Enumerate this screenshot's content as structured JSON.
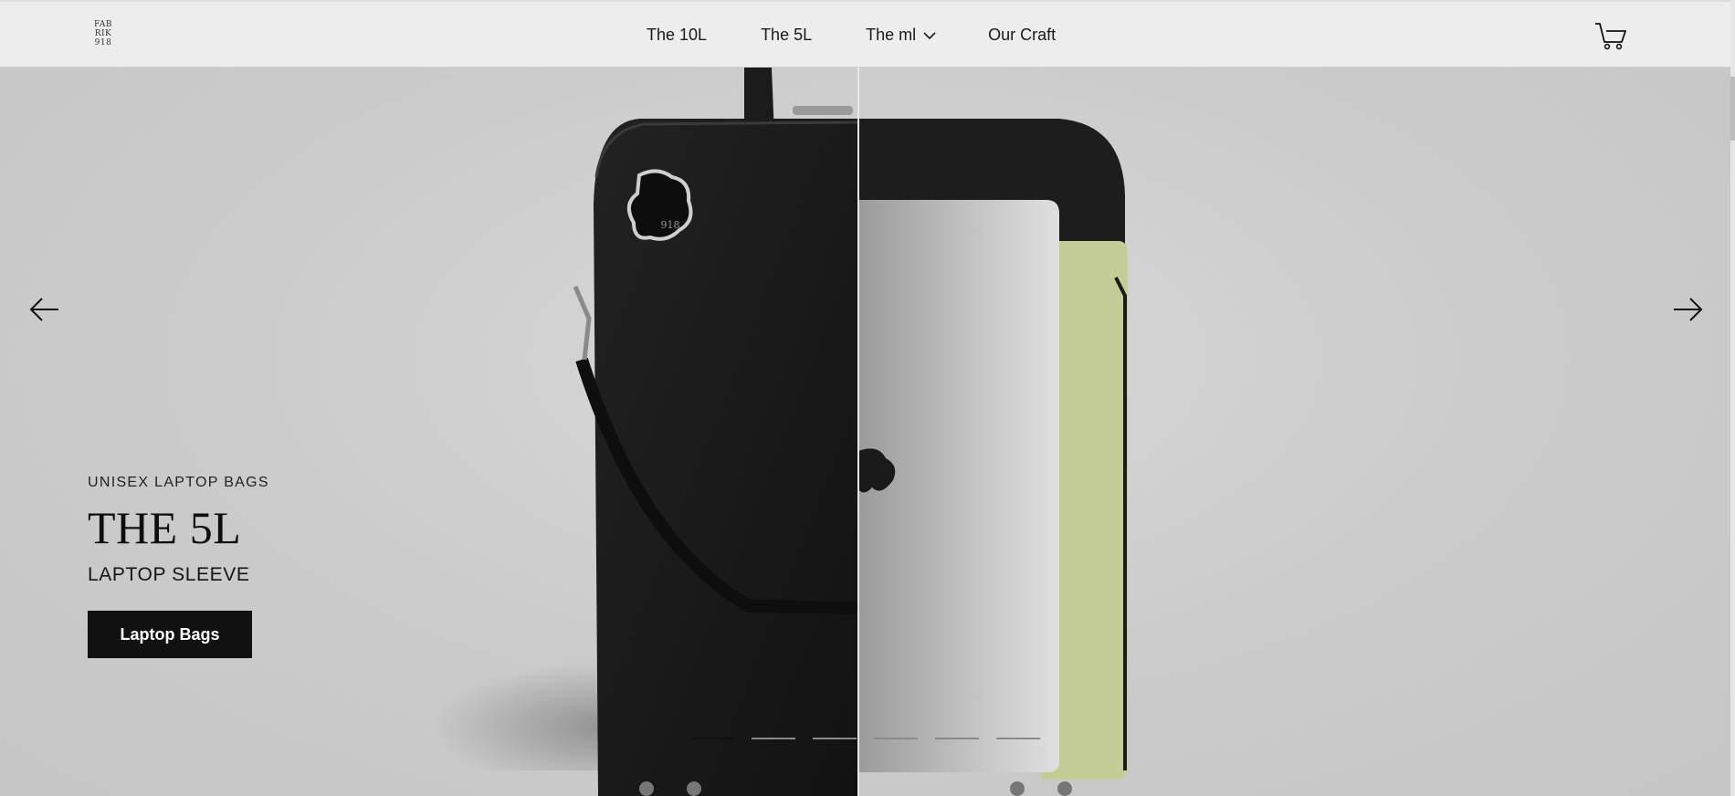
{
  "header": {
    "logo_lines": [
      "FAB",
      "RIK",
      "918"
    ],
    "nav": [
      {
        "label": "The 10L"
      },
      {
        "label": "The 5L"
      },
      {
        "label": "The ml"
      },
      {
        "label": "Our Craft"
      }
    ],
    "cart_icon": "cart-icon"
  },
  "hero": {
    "eyebrow": "UNISEX LAPTOP BAGS",
    "title": "THE 5L",
    "subtitle": "LAPTOP SLEEVE",
    "cta_label": "Laptop Bags",
    "badge_text": "918",
    "prev_icon": "arrow-left-icon",
    "next_icon": "arrow-right-icon",
    "slides_total": 6,
    "active_slide": 1
  },
  "colors": {
    "header_bg": "#ededed",
    "hero_bg": "#d0d0d0",
    "bag_leather": "#1a1a1a",
    "sleeve_green": "#c4cd96",
    "cta_bg": "#111111"
  }
}
